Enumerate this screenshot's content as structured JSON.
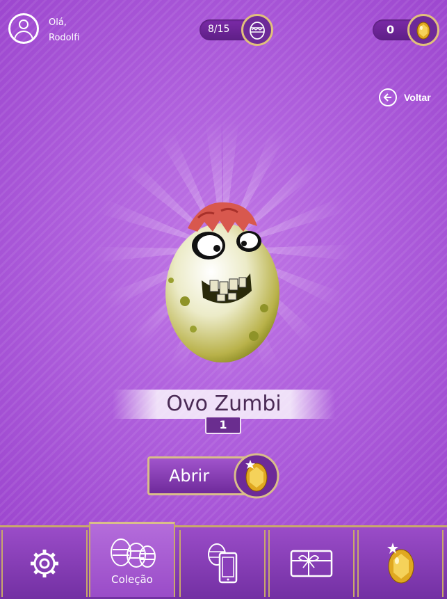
{
  "header": {
    "greeting": "Olá,",
    "username": "Rodolfi",
    "eggs_collected": "8/15",
    "coins": "0"
  },
  "back_label": "Voltar",
  "egg": {
    "name": "Ovo Zumbi",
    "count": "1"
  },
  "open_button_label": "Abrir",
  "nav": {
    "collection_label": "Coleção"
  },
  "colors": {
    "background": "#a64fd6",
    "accent_gold": "#d9bd8a",
    "pill": "#5e1f86"
  }
}
